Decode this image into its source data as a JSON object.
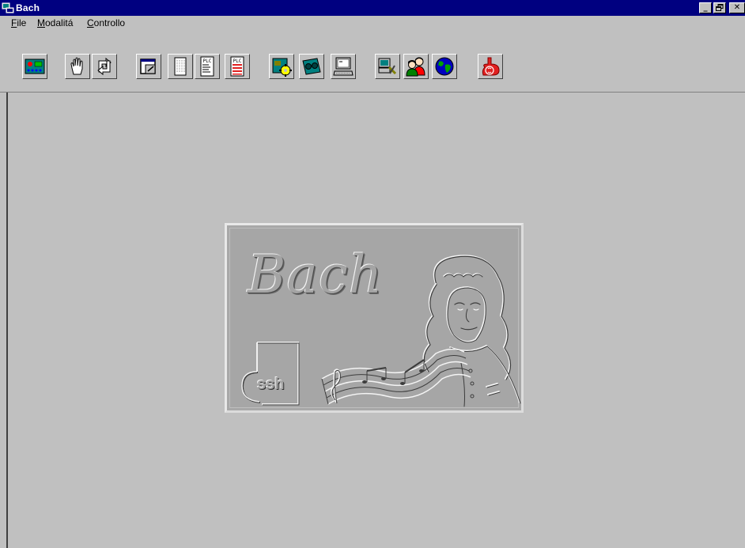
{
  "window": {
    "title": "Bach",
    "controls": {
      "minimize": "_",
      "restore": "ð",
      "close": "×"
    }
  },
  "menu": [
    {
      "label": "File",
      "mnemonic": "F",
      "rest": "ile"
    },
    {
      "label": "Modalitá",
      "mnemonic": "M",
      "rest": "odalitá"
    },
    {
      "label": "Controllo",
      "mnemonic": "C",
      "rest": "ontrollo"
    }
  ],
  "toolbar": {
    "buttons": [
      {
        "name": "io-panel-button",
        "icon": "io-panel-icon"
      },
      {
        "name": "manual-button",
        "icon": "hand-icon"
      },
      {
        "name": "cycle-button",
        "icon": "cycle-arrows-icon"
      },
      {
        "name": "window-edit-button",
        "icon": "window-edit-icon"
      },
      {
        "name": "page-button",
        "icon": "dotted-page-icon"
      },
      {
        "name": "plc-program-button",
        "icon": "plc-document-icon",
        "label": "PLC"
      },
      {
        "name": "plc-program-red-button",
        "icon": "plc-document-red-icon",
        "label": "PLC"
      },
      {
        "name": "machine-gear-button",
        "icon": "gear-machine-icon"
      },
      {
        "name": "tape-button",
        "icon": "tape-icon"
      },
      {
        "name": "terminal-button",
        "icon": "terminal-icon"
      },
      {
        "name": "computer-tools-button",
        "icon": "computer-tools-icon"
      },
      {
        "name": "users-button",
        "icon": "users-icon"
      },
      {
        "name": "globe-button",
        "icon": "globe-icon"
      },
      {
        "name": "company-logo-button",
        "icon": "company-logo-icon"
      }
    ]
  },
  "splash": {
    "title": "Bach",
    "logo_text": "ssh"
  },
  "colors": {
    "titlebar": "#000080",
    "face": "#c0c0c0",
    "accent_red": "#e02020"
  }
}
